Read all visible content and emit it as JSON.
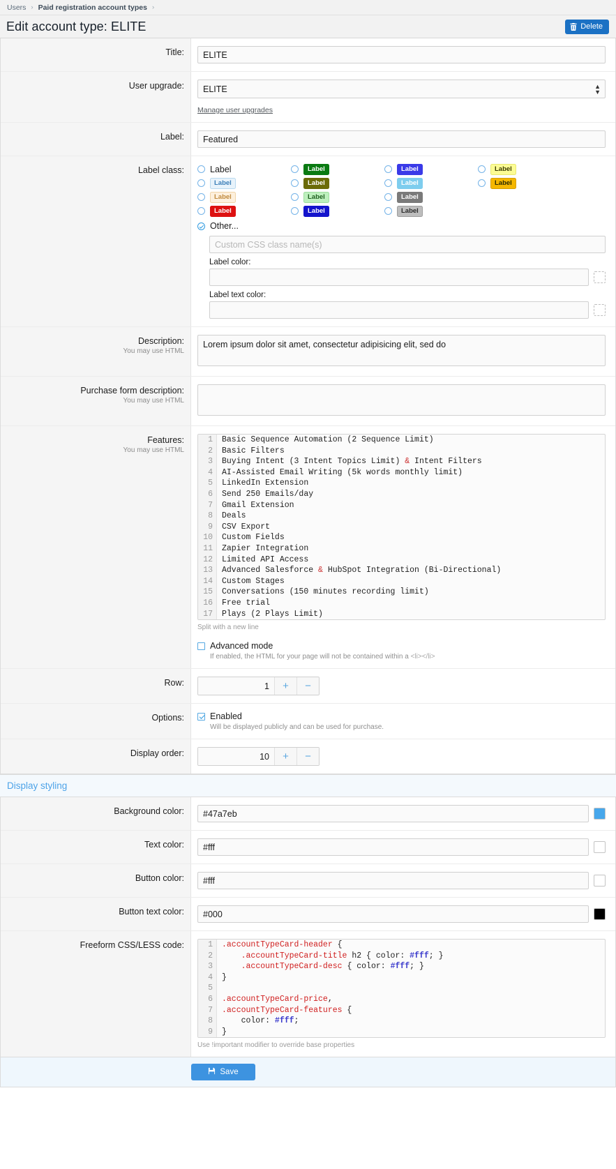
{
  "breadcrumb": {
    "items": [
      "Users",
      "Paid registration account types"
    ]
  },
  "header": {
    "title": "Edit account type: ELITE",
    "delete_label": "Delete"
  },
  "fields": {
    "title": {
      "label": "Title:",
      "value": "ELITE"
    },
    "user_upgrade": {
      "label": "User upgrade:",
      "value": "ELITE",
      "link": "Manage user upgrades"
    },
    "label": {
      "label": "Label:",
      "value": "Featured"
    },
    "label_class": {
      "label": "Label class:",
      "options": [
        {
          "text": "Label",
          "style": "plain"
        },
        {
          "text": "Label",
          "bg": "#e8f3fb",
          "fg": "#3c7fb8",
          "border": "#b8d9ef"
        },
        {
          "text": "Label",
          "bg": "#fdf0dd",
          "fg": "#c08a3e",
          "border": "#f0d4a8"
        },
        {
          "text": "Label",
          "bg": "#dd1111",
          "fg": "#ffffff",
          "border": "#dd1111"
        },
        {
          "text": "Label",
          "bg": "#0a7a12",
          "fg": "#ffffff",
          "border": "#0a7a12"
        },
        {
          "text": "Label",
          "bg": "#6b6b08",
          "fg": "#ffffff",
          "border": "#6b6b08"
        },
        {
          "text": "Label",
          "bg": "#bdf0bd",
          "fg": "#1f5f1f",
          "border": "#9ddd9d"
        },
        {
          "text": "Label",
          "bg": "#1414cc",
          "fg": "#ffffff",
          "border": "#1414cc"
        },
        {
          "text": "Label",
          "bg": "#3a3ae8",
          "fg": "#ffffff",
          "border": "#3a3ae8"
        },
        {
          "text": "Label",
          "bg": "#7ecdee",
          "fg": "#ffffff",
          "border": "#7ecdee"
        },
        {
          "text": "Label",
          "bg": "#7a7a7a",
          "fg": "#ffffff",
          "border": "#7a7a7a"
        },
        {
          "text": "Label",
          "bg": "#bdbdbd",
          "fg": "#2b2b2b",
          "border": "#9e9e9e"
        },
        {
          "text": "Label",
          "bg": "#fcfc94",
          "fg": "#3c3c00",
          "border": "#e8e870"
        },
        {
          "text": "Label",
          "bg": "#f5b700",
          "fg": "#2b2b00",
          "border": "#d8a000"
        }
      ],
      "other_label": "Other...",
      "custom_class_placeholder": "Custom CSS class name(s)",
      "custom_class_value": "",
      "label_color_label": "Label color:",
      "label_color_value": "",
      "label_text_color_label": "Label text color:",
      "label_text_color_value": ""
    },
    "description": {
      "label": "Description:",
      "hint": "You may use HTML",
      "value": "Lorem ipsum dolor sit amet, consectetur adipisicing elit, sed do"
    },
    "purchase_form_description": {
      "label": "Purchase form description:",
      "hint": "You may use HTML",
      "value": ""
    },
    "features": {
      "label": "Features:",
      "hint": "You may use HTML",
      "helper": "Split with a new line",
      "lines": [
        "Basic Sequence Automation (2 Sequence Limit)",
        "Basic Filters",
        "Buying Intent (3 Intent Topics Limit) & Intent Filters",
        "AI-Assisted Email Writing (5k words monthly limit)",
        "LinkedIn Extension",
        "Send 250 Emails/day",
        "Gmail Extension",
        "Deals",
        "CSV Export",
        "Custom Fields",
        "Zapier Integration",
        "Limited API Access",
        "Advanced Salesforce & HubSpot Integration (Bi-Directional)",
        "Custom Stages",
        "Conversations (150 minutes recording limit)",
        "Free trial",
        "Plays (2 Plays Limit)"
      ]
    },
    "advanced_mode": {
      "label": "Advanced mode",
      "checked": false,
      "note_prefix": "If enabled, the HTML for your page will not be contained within a ",
      "note_tag": "<li></li>"
    },
    "row": {
      "label": "Row:",
      "value": "1",
      "plus": "+",
      "minus": "−"
    },
    "options": {
      "label": "Options:",
      "enabled_label": "Enabled",
      "enabled_checked": true,
      "note": "Will be displayed publicly and can be used for purchase."
    },
    "display_order": {
      "label": "Display order:",
      "value": "10",
      "plus": "+",
      "minus": "−"
    }
  },
  "display_styling": {
    "section_title": "Display styling",
    "background_color": {
      "label": "Background color:",
      "value": "#47a7eb",
      "swatch": "#47a7eb"
    },
    "text_color": {
      "label": "Text color:",
      "value": "#fff",
      "swatch": "#ffffff"
    },
    "button_color": {
      "label": "Button color:",
      "value": "#fff",
      "swatch": "#ffffff"
    },
    "button_text_color": {
      "label": "Button text color:",
      "value": "#000",
      "swatch": "#000000"
    },
    "css_code": {
      "label": "Freeform CSS/LESS code:",
      "helper": "Use !important modifier to override base properties",
      "lines": [
        ".accountTypeCard-header {",
        "    .accountTypeCard-title h2 { color: #fff; }",
        "    .accountTypeCard-desc { color: #fff; }",
        "}",
        "",
        ".accountTypeCard-price,",
        ".accountTypeCard-features {",
        "    color: #fff;",
        "}"
      ]
    }
  },
  "footer": {
    "save_label": "Save"
  },
  "colors": {
    "accent": "#3d93e0",
    "delete": "#1b71c4",
    "section": "#4da3e8"
  }
}
